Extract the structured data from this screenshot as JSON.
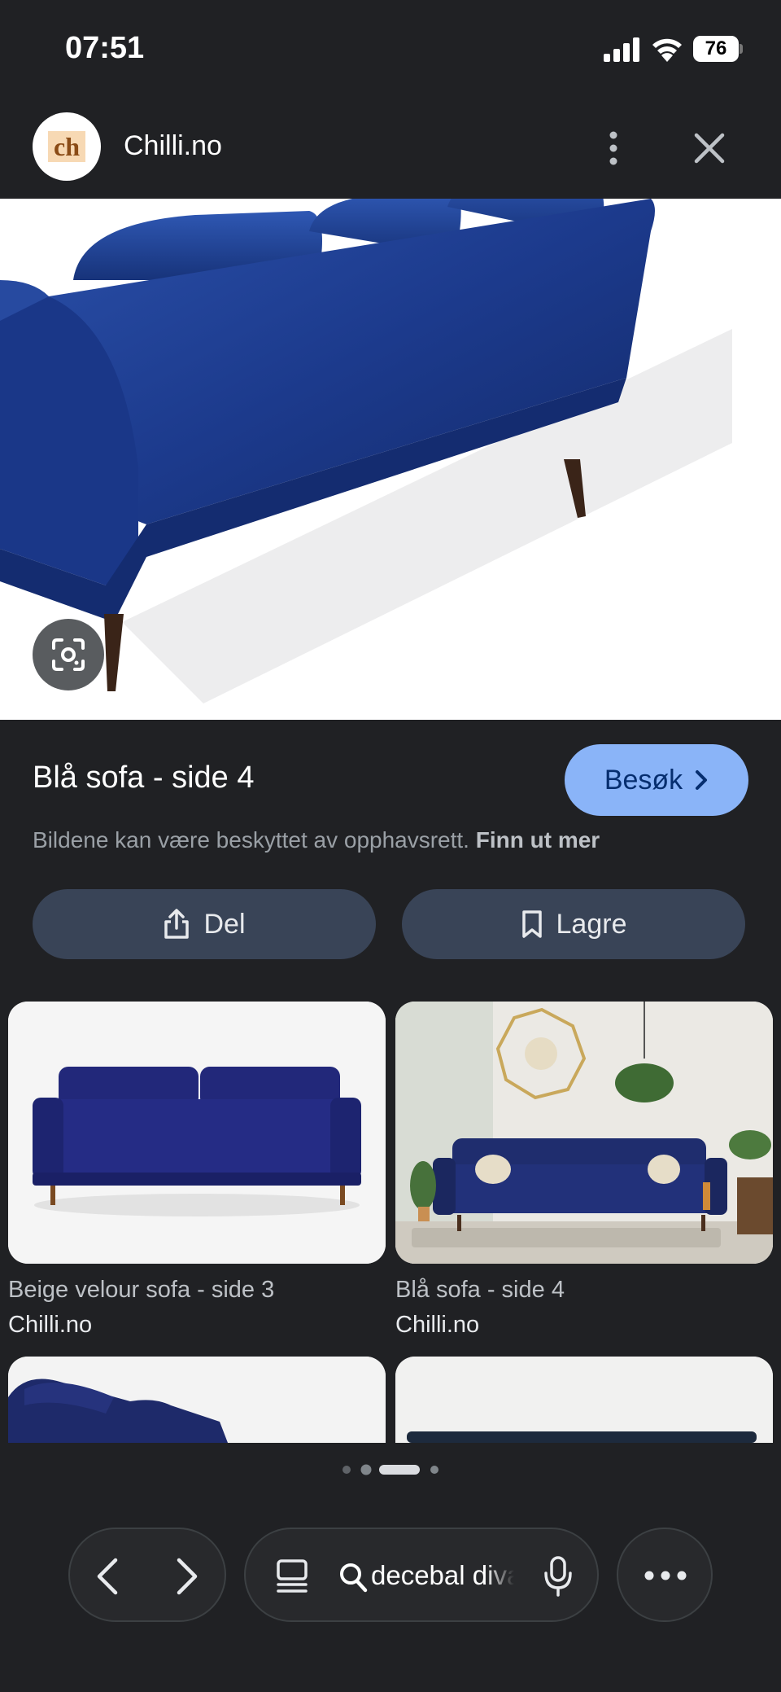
{
  "status_bar": {
    "time": "07:51",
    "battery": "76"
  },
  "header": {
    "logo_text": "ch",
    "site_name": "Chilli.no"
  },
  "result": {
    "title": "Blå sofa - side 4",
    "visit_label": "Besøk",
    "copyright_text": "Bildene kan være beskyttet av opphavsrett.",
    "learn_more": "Finn ut mer",
    "share_label": "Del",
    "save_label": "Lagre"
  },
  "related": [
    {
      "title": "Beige velour sofa - side 3",
      "source": "Chilli.no"
    },
    {
      "title": "Blå sofa - side 4",
      "source": "Chilli.no"
    }
  ],
  "bottom_bar": {
    "search_query": "decebal divan"
  },
  "colors": {
    "accent": "#8ab4f8",
    "button_bg": "#394457",
    "sofa_blue": "#1c3a8c",
    "background": "#202124"
  }
}
